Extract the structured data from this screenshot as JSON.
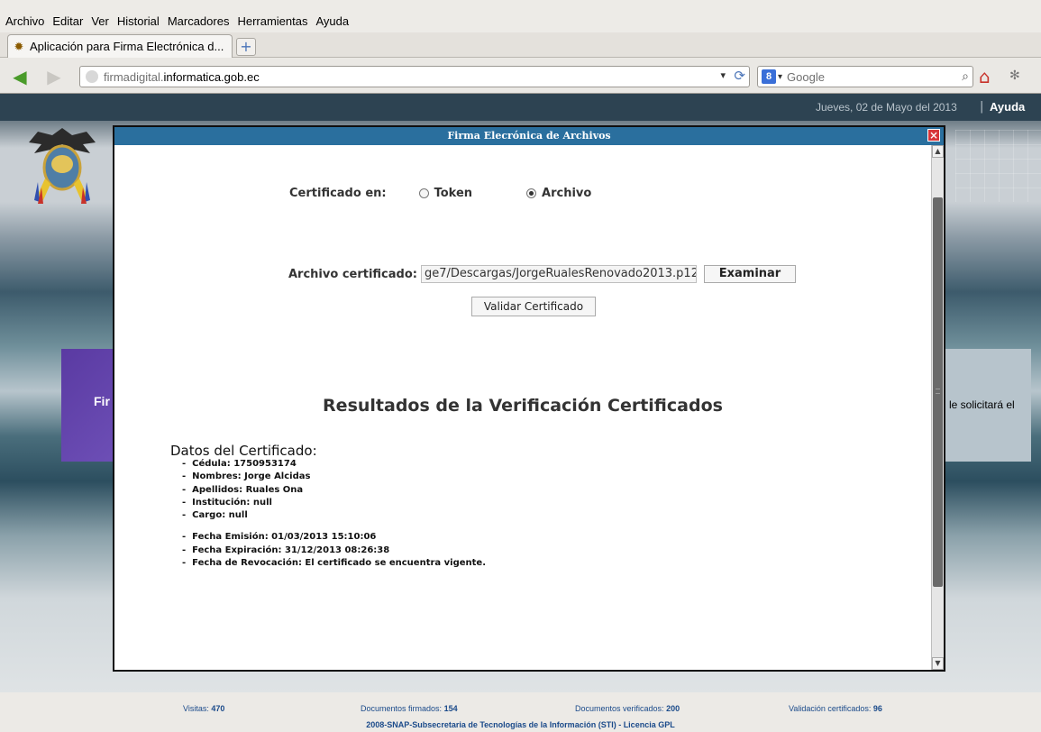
{
  "menu": [
    "Archivo",
    "Editar",
    "Ver",
    "Historial",
    "Marcadores",
    "Herramientas",
    "Ayuda"
  ],
  "tab": {
    "title": "Aplicación para Firma Electrónica d...",
    "favicon": "ecuador-seal-icon"
  },
  "nav": {
    "url_prefix": "firmadigital.",
    "url_host": "informatica.gob.ec",
    "search_placeholder": "Google"
  },
  "header": {
    "date": "Jueves, 02 de Mayo del 2013",
    "separator": "|",
    "help": "Ayuda"
  },
  "background": {
    "left_panel_text": "Fir",
    "right_panel_text": "le solicitará el"
  },
  "modal": {
    "title": "Firma Elecrónica de Archivos",
    "close": "×",
    "cert_label": "Certificado en:",
    "options": [
      {
        "label": "Token",
        "selected": false
      },
      {
        "label": "Archivo",
        "selected": true
      }
    ],
    "file_label": "Archivo certificado:",
    "file_value": "ge7/Descargas/JorgeRualesRenovado2013.p12",
    "browse_button": "Examinar",
    "validate_button": "Validar Certificado",
    "results_title": "Resultados de la Verificación Certificados",
    "datos_title": "Datos del Certificado:",
    "datos": [
      "Cédula: 1750953174",
      "Nombres: Jorge Alcidas",
      "Apellidos: Ruales Ona",
      "Institución: null",
      "Cargo: null"
    ],
    "fechas": [
      "Fecha Emisión: 01/03/2013 15:10:06",
      "Fecha Expiración: 31/12/2013 08:26:38",
      "Fecha de Revocación: El certificado se encuentra vigente."
    ]
  },
  "footer": {
    "visitas_label": "Visitas:",
    "visitas": "470",
    "firmados_label": "Documentos firmados:",
    "firmados": "154",
    "verificados_label": "Documentos verificados:",
    "verificados": "200",
    "validacion_label": "Validación certificados:",
    "validacion": "96",
    "license": "2008-SNAP-Subsecretaria de Tecnologías de la Información (STI) - Licencia GPL"
  }
}
